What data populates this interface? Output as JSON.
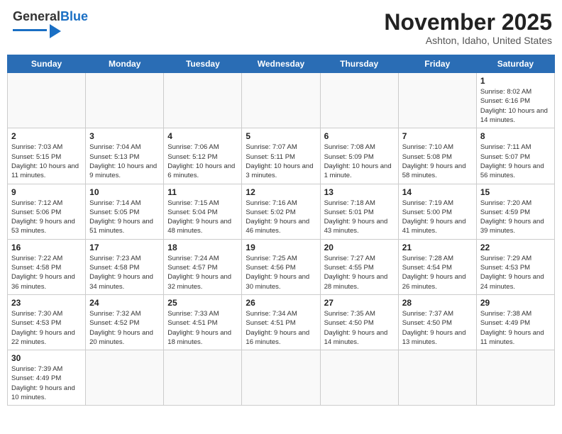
{
  "header": {
    "logo_general": "General",
    "logo_blue": "Blue",
    "month_title": "November 2025",
    "location": "Ashton, Idaho, United States"
  },
  "days_of_week": [
    "Sunday",
    "Monday",
    "Tuesday",
    "Wednesday",
    "Thursday",
    "Friday",
    "Saturday"
  ],
  "weeks": [
    [
      {
        "day": "",
        "info": ""
      },
      {
        "day": "",
        "info": ""
      },
      {
        "day": "",
        "info": ""
      },
      {
        "day": "",
        "info": ""
      },
      {
        "day": "",
        "info": ""
      },
      {
        "day": "",
        "info": ""
      },
      {
        "day": "1",
        "info": "Sunrise: 8:02 AM\nSunset: 6:16 PM\nDaylight: 10 hours and 14 minutes."
      }
    ],
    [
      {
        "day": "2",
        "info": "Sunrise: 7:03 AM\nSunset: 5:15 PM\nDaylight: 10 hours and 11 minutes."
      },
      {
        "day": "3",
        "info": "Sunrise: 7:04 AM\nSunset: 5:13 PM\nDaylight: 10 hours and 9 minutes."
      },
      {
        "day": "4",
        "info": "Sunrise: 7:06 AM\nSunset: 5:12 PM\nDaylight: 10 hours and 6 minutes."
      },
      {
        "day": "5",
        "info": "Sunrise: 7:07 AM\nSunset: 5:11 PM\nDaylight: 10 hours and 3 minutes."
      },
      {
        "day": "6",
        "info": "Sunrise: 7:08 AM\nSunset: 5:09 PM\nDaylight: 10 hours and 1 minute."
      },
      {
        "day": "7",
        "info": "Sunrise: 7:10 AM\nSunset: 5:08 PM\nDaylight: 9 hours and 58 minutes."
      },
      {
        "day": "8",
        "info": "Sunrise: 7:11 AM\nSunset: 5:07 PM\nDaylight: 9 hours and 56 minutes."
      }
    ],
    [
      {
        "day": "9",
        "info": "Sunrise: 7:12 AM\nSunset: 5:06 PM\nDaylight: 9 hours and 53 minutes."
      },
      {
        "day": "10",
        "info": "Sunrise: 7:14 AM\nSunset: 5:05 PM\nDaylight: 9 hours and 51 minutes."
      },
      {
        "day": "11",
        "info": "Sunrise: 7:15 AM\nSunset: 5:04 PM\nDaylight: 9 hours and 48 minutes."
      },
      {
        "day": "12",
        "info": "Sunrise: 7:16 AM\nSunset: 5:02 PM\nDaylight: 9 hours and 46 minutes."
      },
      {
        "day": "13",
        "info": "Sunrise: 7:18 AM\nSunset: 5:01 PM\nDaylight: 9 hours and 43 minutes."
      },
      {
        "day": "14",
        "info": "Sunrise: 7:19 AM\nSunset: 5:00 PM\nDaylight: 9 hours and 41 minutes."
      },
      {
        "day": "15",
        "info": "Sunrise: 7:20 AM\nSunset: 4:59 PM\nDaylight: 9 hours and 39 minutes."
      }
    ],
    [
      {
        "day": "16",
        "info": "Sunrise: 7:22 AM\nSunset: 4:58 PM\nDaylight: 9 hours and 36 minutes."
      },
      {
        "day": "17",
        "info": "Sunrise: 7:23 AM\nSunset: 4:58 PM\nDaylight: 9 hours and 34 minutes."
      },
      {
        "day": "18",
        "info": "Sunrise: 7:24 AM\nSunset: 4:57 PM\nDaylight: 9 hours and 32 minutes."
      },
      {
        "day": "19",
        "info": "Sunrise: 7:25 AM\nSunset: 4:56 PM\nDaylight: 9 hours and 30 minutes."
      },
      {
        "day": "20",
        "info": "Sunrise: 7:27 AM\nSunset: 4:55 PM\nDaylight: 9 hours and 28 minutes."
      },
      {
        "day": "21",
        "info": "Sunrise: 7:28 AM\nSunset: 4:54 PM\nDaylight: 9 hours and 26 minutes."
      },
      {
        "day": "22",
        "info": "Sunrise: 7:29 AM\nSunset: 4:53 PM\nDaylight: 9 hours and 24 minutes."
      }
    ],
    [
      {
        "day": "23",
        "info": "Sunrise: 7:30 AM\nSunset: 4:53 PM\nDaylight: 9 hours and 22 minutes."
      },
      {
        "day": "24",
        "info": "Sunrise: 7:32 AM\nSunset: 4:52 PM\nDaylight: 9 hours and 20 minutes."
      },
      {
        "day": "25",
        "info": "Sunrise: 7:33 AM\nSunset: 4:51 PM\nDaylight: 9 hours and 18 minutes."
      },
      {
        "day": "26",
        "info": "Sunrise: 7:34 AM\nSunset: 4:51 PM\nDaylight: 9 hours and 16 minutes."
      },
      {
        "day": "27",
        "info": "Sunrise: 7:35 AM\nSunset: 4:50 PM\nDaylight: 9 hours and 14 minutes."
      },
      {
        "day": "28",
        "info": "Sunrise: 7:37 AM\nSunset: 4:50 PM\nDaylight: 9 hours and 13 minutes."
      },
      {
        "day": "29",
        "info": "Sunrise: 7:38 AM\nSunset: 4:49 PM\nDaylight: 9 hours and 11 minutes."
      }
    ],
    [
      {
        "day": "30",
        "info": "Sunrise: 7:39 AM\nSunset: 4:49 PM\nDaylight: 9 hours and 10 minutes."
      },
      {
        "day": "",
        "info": ""
      },
      {
        "day": "",
        "info": ""
      },
      {
        "day": "",
        "info": ""
      },
      {
        "day": "",
        "info": ""
      },
      {
        "day": "",
        "info": ""
      },
      {
        "day": "",
        "info": ""
      }
    ]
  ]
}
